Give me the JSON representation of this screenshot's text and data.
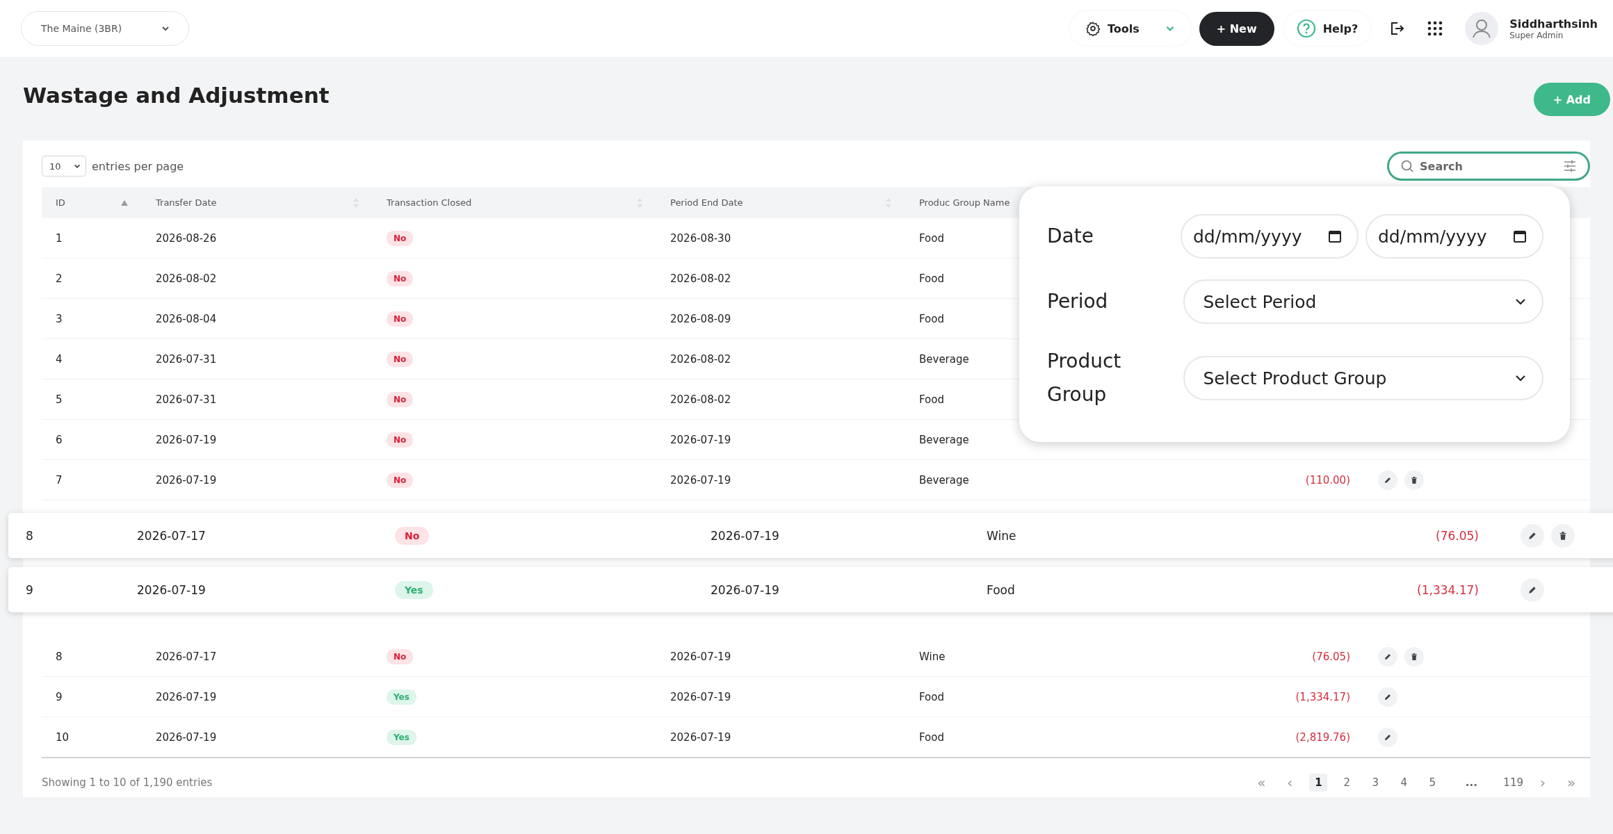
{
  "topbar": {
    "location_select": "The Maine (3BR)",
    "tools": "Tools",
    "new_button": "+ New",
    "help": "Help?",
    "user": {
      "name": "Siddharthsinh",
      "role": "Super Admin"
    }
  },
  "page": {
    "title": "Wastage and Adjustment",
    "add_button": "+ Add"
  },
  "table": {
    "page_size": "10",
    "page_size_label": "entries per page",
    "search": {
      "placeholder": "Search"
    },
    "columns": [
      {
        "label": "ID",
        "sorted": true
      },
      {
        "label": "Transfer Date",
        "sorted": false
      },
      {
        "label": "Transaction Closed",
        "sorted": false
      },
      {
        "label": "Period End Date",
        "sorted": false
      },
      {
        "label": "Produc Group Name"
      }
    ],
    "rows": [
      {
        "id": "1",
        "transfer_date": "2026-08-26",
        "closed": false,
        "closed_text": "No",
        "period_end": "2026-08-30",
        "group": "Food"
      },
      {
        "id": "2",
        "transfer_date": "2026-08-02",
        "closed": false,
        "closed_text": "No",
        "period_end": "2026-08-02",
        "group": "Food"
      },
      {
        "id": "3",
        "transfer_date": "2026-08-04",
        "closed": false,
        "closed_text": "No",
        "period_end": "2026-08-09",
        "group": "Food"
      },
      {
        "id": "4",
        "transfer_date": "2026-07-31",
        "closed": false,
        "closed_text": "No",
        "period_end": "2026-08-02",
        "group": "Beverage"
      },
      {
        "id": "5",
        "transfer_date": "2026-07-31",
        "closed": false,
        "closed_text": "No",
        "period_end": "2026-08-02",
        "group": "Food"
      },
      {
        "id": "6",
        "transfer_date": "2026-07-19",
        "closed": false,
        "closed_text": "No",
        "period_end": "2026-07-19",
        "group": "Beverage"
      },
      {
        "id": "7",
        "transfer_date": "2026-07-19",
        "closed": false,
        "closed_text": "No",
        "period_end": "2026-07-19",
        "group": "Beverage",
        "amount": "(110.00)",
        "editable": true,
        "deletable": true
      }
    ],
    "floating_rows": [
      {
        "id": "8",
        "transfer_date": "2026-07-17",
        "closed": false,
        "closed_text": "No",
        "period_end": "2026-07-19",
        "group": "Wine",
        "amount": "(76.05)",
        "editable": true,
        "deletable": true
      },
      {
        "id": "9",
        "transfer_date": "2026-07-19",
        "closed": true,
        "closed_text": "Yes",
        "period_end": "2026-07-19",
        "group": "Food",
        "amount": "(1,334.17)",
        "editable": true,
        "deletable": false
      }
    ],
    "rows_after": [
      {
        "id": "8",
        "transfer_date": "2026-07-17",
        "closed": false,
        "closed_text": "No",
        "period_end": "2026-07-19",
        "group": "Wine",
        "amount": "(76.05)",
        "editable": true,
        "deletable": true
      },
      {
        "id": "9",
        "transfer_date": "2026-07-19",
        "closed": true,
        "closed_text": "Yes",
        "period_end": "2026-07-19",
        "group": "Food",
        "amount": "(1,334.17)",
        "editable": true,
        "deletable": false
      },
      {
        "id": "10",
        "transfer_date": "2026-07-19",
        "closed": true,
        "closed_text": "Yes",
        "period_end": "2026-07-19",
        "group": "Food",
        "amount": "(2,819.76)",
        "editable": true,
        "deletable": false
      }
    ],
    "footer": "Showing 1 to 10 of 1,190 entries",
    "pagination": [
      {
        "label": "«",
        "kind": "nav"
      },
      {
        "label": "‹",
        "kind": "nav"
      },
      {
        "label": "1",
        "kind": "page",
        "selected": true
      },
      {
        "label": "2",
        "kind": "page",
        "selected": false
      },
      {
        "label": "3",
        "kind": "page",
        "selected": false
      },
      {
        "label": "4",
        "kind": "page",
        "selected": false
      },
      {
        "label": "5",
        "kind": "page",
        "selected": false
      },
      {
        "label": "...",
        "kind": "gap"
      },
      {
        "label": "119",
        "kind": "page",
        "selected": false
      },
      {
        "label": "›",
        "kind": "nav"
      },
      {
        "label": "»",
        "kind": "nav"
      }
    ]
  },
  "filter_panel": {
    "fields": [
      {
        "label": "Date",
        "kind": "date_range",
        "from": {
          "placeholder": "dd/mm/yyyy"
        },
        "to": {
          "placeholder": "dd/mm/yyyy"
        }
      },
      {
        "label": "Period",
        "kind": "select",
        "placeholder": "Select Period"
      },
      {
        "label": "Product Group",
        "kind": "select",
        "placeholder": "Select Product Group"
      }
    ]
  }
}
